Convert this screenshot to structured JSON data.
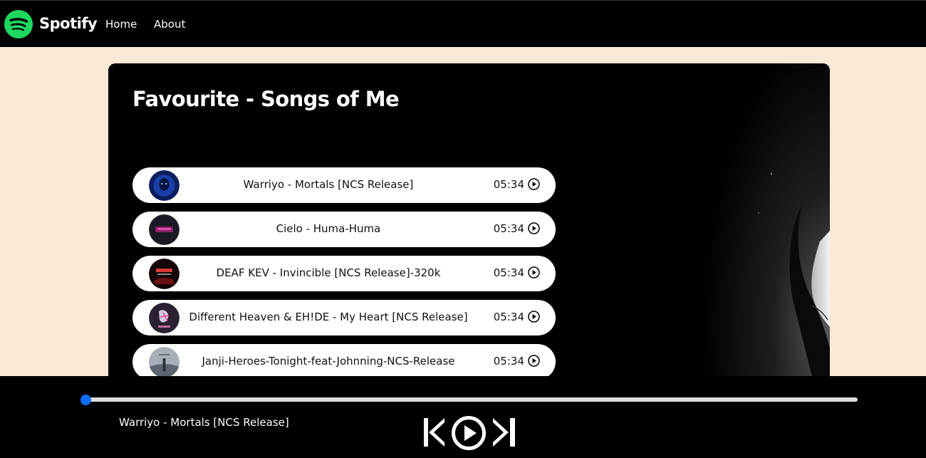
{
  "nav": {
    "brand": "Spotify",
    "links": [
      "Home",
      "About"
    ]
  },
  "playlist": {
    "title": "Favourite - Songs of Me",
    "songs": [
      {
        "name": "Warriyo - Mortals [NCS Release]",
        "duration": "05:34"
      },
      {
        "name": "Cielo - Huma-Huma",
        "duration": "05:34"
      },
      {
        "name": "DEAF KEV - Invincible [NCS Release]-320k",
        "duration": "05:34"
      },
      {
        "name": "Different Heaven & EH!DE - My Heart [NCS Release]",
        "duration": "05:34"
      },
      {
        "name": "Janji-Heroes-Tonight-feat-Johnning-NCS-Release",
        "duration": "05:34"
      }
    ]
  },
  "player": {
    "now_playing": "Warriyo - Mortals [NCS Release]",
    "progress_percent": 0
  },
  "colors": {
    "accent": "#0d6efd",
    "brand_green": "#1ed760",
    "page_bg": "#fbe9d7"
  }
}
